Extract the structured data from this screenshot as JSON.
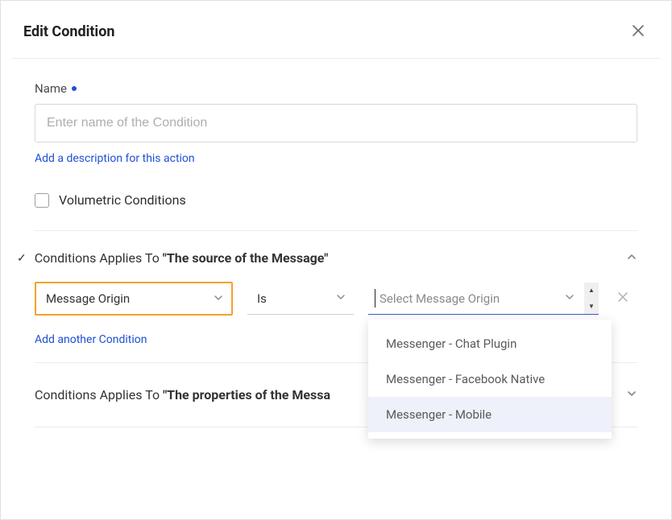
{
  "dialog": {
    "title": "Edit Condition"
  },
  "name_field": {
    "label": "Name",
    "placeholder": "Enter name of the Condition",
    "value": ""
  },
  "add_description_link": "Add a description for this action",
  "volumetric": {
    "label": "Volumetric Conditions",
    "checked": false
  },
  "section1": {
    "prefix": "Conditions Applies To ",
    "quoted": "\"The source of the Message\"",
    "expanded": true,
    "row": {
      "attribute": "Message Origin",
      "operator": "Is",
      "value_placeholder": "Select Message Origin"
    },
    "options": [
      "Messenger - Chat Plugin",
      "Messenger - Facebook Native",
      "Messenger - Mobile"
    ],
    "highlighted_index": 2,
    "add_another": "Add another Condition"
  },
  "section2": {
    "prefix": "Conditions Applies To ",
    "quoted": "\"The properties of the Messa",
    "expanded": false
  }
}
